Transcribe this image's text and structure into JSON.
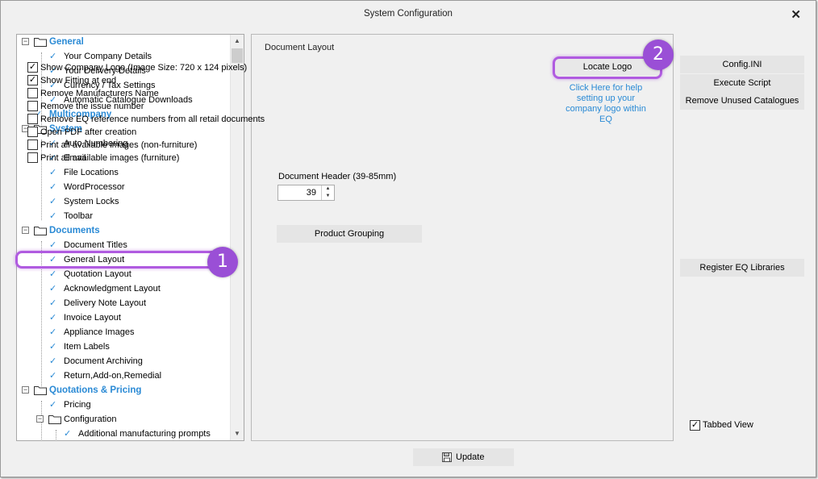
{
  "window": {
    "title": "System Configuration",
    "close": "✕"
  },
  "tree": {
    "general": "General",
    "your_company": "Your Company Details",
    "your_delivery": "Your Delivery Details",
    "currency": "Currency / Tax Settings",
    "auto_catalogue": "Automatic Catalogue Downloads",
    "multicompany": "Multicompany",
    "system": "System",
    "auto_numbering": "Auto Numbering",
    "email": "Email",
    "file_locations": "File Locations",
    "wordprocessor": "WordProcessor",
    "system_locks": "System Locks",
    "toolbar": "Toolbar",
    "documents": "Documents",
    "document_titles": "Document Titles",
    "general_layout": "General Layout",
    "quotation_layout": "Quotation Layout",
    "ack_layout": "Acknowledgment Layout",
    "delivery_layout": "Delivery Note Layout",
    "invoice_layout": "Invoice Layout",
    "appliance_images": "Appliance Images",
    "item_labels": "Item Labels",
    "doc_archiving": "Document Archiving",
    "return_addon": "Return,Add-on,Remedial",
    "quotations_pricing": "Quotations & Pricing",
    "pricing": "Pricing",
    "configuration": "Configuration",
    "additional_prompts": "Additional manufacturing prompts"
  },
  "document_layout": {
    "group_title": "Document Layout",
    "options": [
      {
        "label": "Show Company Logo  (Image Size: 720 x 124 pixels)",
        "checked": true
      },
      {
        "label": "Show Fitting at end",
        "checked": true
      },
      {
        "label": "Remove Manufacturers Name",
        "checked": false
      },
      {
        "label": "Remove the issue number",
        "checked": false
      },
      {
        "label": "Remove EQ reference numbers from all retail documents",
        "checked": false
      },
      {
        "label": "Open PDF after creation",
        "checked": false
      },
      {
        "label": "Print all available images (non-furniture)",
        "checked": false
      },
      {
        "label": "Print all available images (furniture)",
        "checked": false
      }
    ],
    "header_label": "Document Header (39-85mm)",
    "header_value": "39",
    "product_grouping": "Product Grouping",
    "locate_logo": "Locate Logo",
    "help_text": "Click Here for help setting up your company logo within EQ"
  },
  "side_buttons": {
    "config_ini": "Config.INI",
    "execute_script": "Execute Script",
    "remove_unused": "Remove Unused Catalogues",
    "register_eq": "Register EQ Libraries"
  },
  "tabbed_view": {
    "label": "Tabbed View",
    "checked": true
  },
  "update_button": "Update",
  "annotations": {
    "badge1": "1",
    "badge2": "2"
  },
  "colors": {
    "accent": "#2a8ad5",
    "highlight": "#b05be0",
    "badge": "#9a4fd6"
  }
}
